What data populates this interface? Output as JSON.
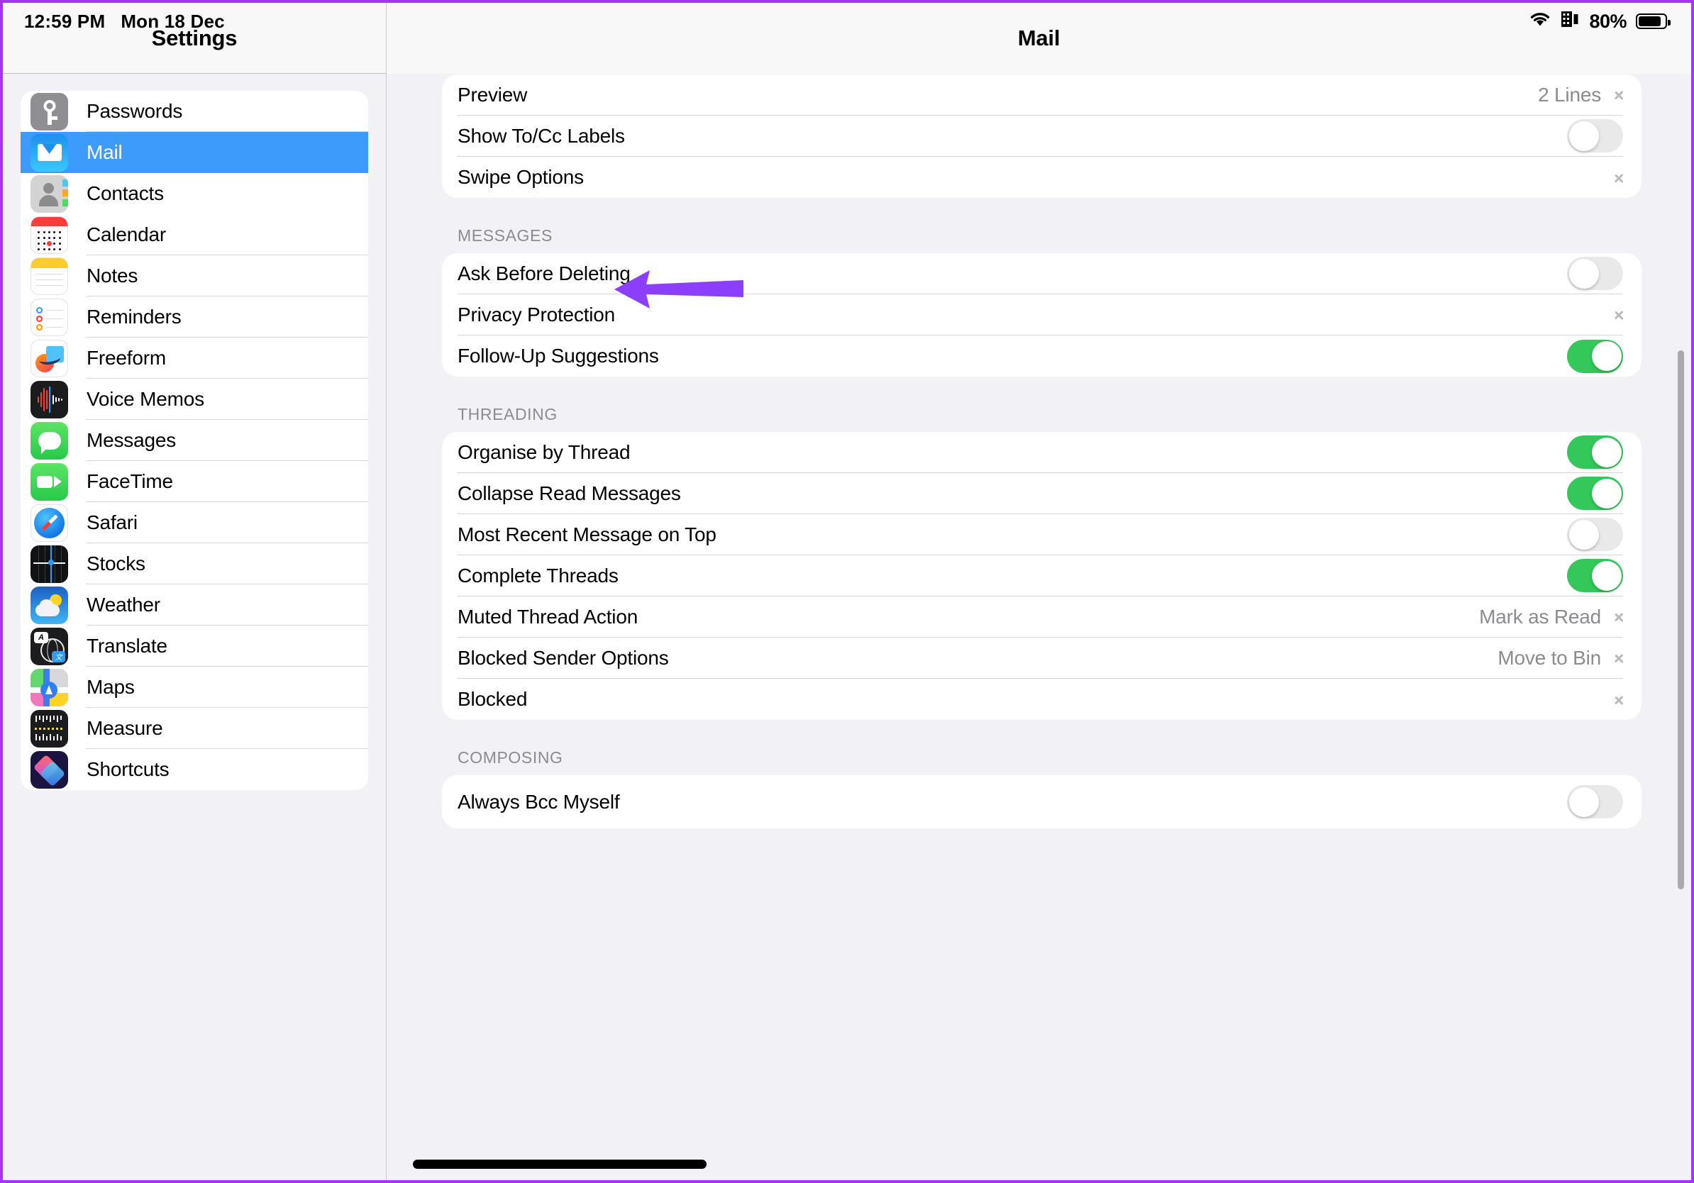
{
  "status_bar": {
    "time": "12:59 PM",
    "date": "Mon 18 Dec",
    "wifi_icon": "wifi-icon",
    "cellular_icon": "battery-health-icon",
    "battery_percent": "80%"
  },
  "sidebar": {
    "title": "Settings",
    "items": [
      {
        "label": "Passwords",
        "icon": "passwords-icon",
        "selected": false
      },
      {
        "label": "Mail",
        "icon": "mail-icon",
        "selected": true
      },
      {
        "label": "Contacts",
        "icon": "contacts-icon",
        "selected": false
      },
      {
        "label": "Calendar",
        "icon": "calendar-icon",
        "selected": false
      },
      {
        "label": "Notes",
        "icon": "notes-icon",
        "selected": false
      },
      {
        "label": "Reminders",
        "icon": "reminders-icon",
        "selected": false
      },
      {
        "label": "Freeform",
        "icon": "freeform-icon",
        "selected": false
      },
      {
        "label": "Voice Memos",
        "icon": "voice-memos-icon",
        "selected": false
      },
      {
        "label": "Messages",
        "icon": "messages-icon",
        "selected": false
      },
      {
        "label": "FaceTime",
        "icon": "facetime-icon",
        "selected": false
      },
      {
        "label": "Safari",
        "icon": "safari-icon",
        "selected": false
      },
      {
        "label": "Stocks",
        "icon": "stocks-icon",
        "selected": false
      },
      {
        "label": "Weather",
        "icon": "weather-icon",
        "selected": false
      },
      {
        "label": "Translate",
        "icon": "translate-icon",
        "selected": false
      },
      {
        "label": "Maps",
        "icon": "maps-icon",
        "selected": false
      },
      {
        "label": "Measure",
        "icon": "measure-icon",
        "selected": false
      },
      {
        "label": "Shortcuts",
        "icon": "shortcuts-icon",
        "selected": false
      }
    ]
  },
  "detail": {
    "title": "Mail",
    "groups": [
      {
        "header": "",
        "rows": [
          {
            "label": "Preview",
            "type": "value",
            "value": "2 Lines",
            "clipped": true
          },
          {
            "label": "Show To/Cc Labels",
            "type": "toggle",
            "on": false
          },
          {
            "label": "Swipe Options",
            "type": "chevron"
          }
        ]
      },
      {
        "header": "MESSAGES",
        "rows": [
          {
            "label": "Ask Before Deleting",
            "type": "toggle",
            "on": false
          },
          {
            "label": "Privacy Protection",
            "type": "chevron",
            "annotated": true
          },
          {
            "label": "Follow-Up Suggestions",
            "type": "toggle",
            "on": true
          }
        ]
      },
      {
        "header": "THREADING",
        "rows": [
          {
            "label": "Organise by Thread",
            "type": "toggle",
            "on": true
          },
          {
            "label": "Collapse Read Messages",
            "type": "toggle",
            "on": true
          },
          {
            "label": "Most Recent Message on Top",
            "type": "toggle",
            "on": false
          },
          {
            "label": "Complete Threads",
            "type": "toggle",
            "on": true
          },
          {
            "label": "Muted Thread Action",
            "type": "value",
            "value": "Mark as Read"
          },
          {
            "label": "Blocked Sender Options",
            "type": "value",
            "value": "Move to Bin"
          },
          {
            "label": "Blocked",
            "type": "chevron"
          }
        ]
      },
      {
        "header": "COMPOSING",
        "rows": [
          {
            "label": "Always Bcc Myself",
            "type": "toggle",
            "on": false
          }
        ]
      }
    ]
  },
  "annotation": {
    "kind": "arrow-left",
    "target": "Privacy Protection",
    "color": "#8B3FFA"
  },
  "colors": {
    "accent_selected": "#3C9BFB",
    "toggle_on": "#34C759",
    "toggle_off": "#E9E9EA",
    "page_background": "#F2F1F6",
    "card_background": "#FFFFFF",
    "secondary_text": "#8B8B90",
    "annotation_purple": "#8B3FFA",
    "frame_border": "#A832F5"
  }
}
